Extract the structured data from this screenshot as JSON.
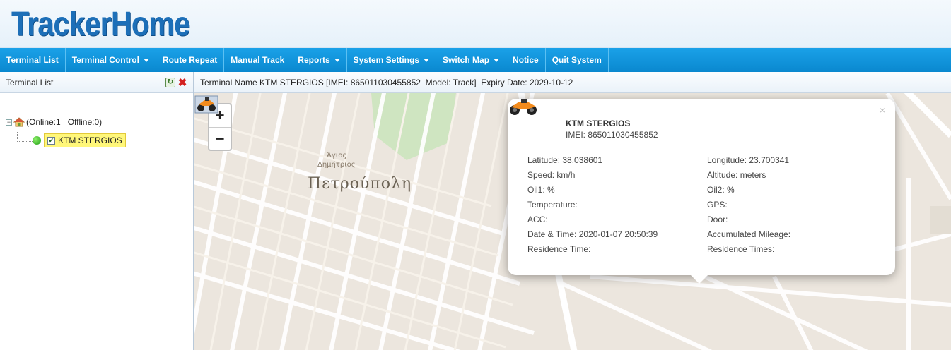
{
  "app": {
    "logo": "TrackerHome"
  },
  "nav": [
    {
      "label": "Terminal List",
      "dropdown": false
    },
    {
      "label": "Terminal Control",
      "dropdown": true
    },
    {
      "label": "Route Repeat",
      "dropdown": false
    },
    {
      "label": "Manual Track",
      "dropdown": false
    },
    {
      "label": "Reports",
      "dropdown": true
    },
    {
      "label": "System Settings",
      "dropdown": true
    },
    {
      "label": "Switch Map",
      "dropdown": true
    },
    {
      "label": "Notice",
      "dropdown": false
    },
    {
      "label": "Quit System",
      "dropdown": false
    }
  ],
  "sidebar": {
    "title": "Terminal List",
    "group_label": "(Online:1   Offline:0)",
    "device_name": "KTM STERGIOS"
  },
  "info_bar": {
    "text": "Terminal Name KTM STERGIOS [IMEI: 865011030455852  Model: Track]  Expiry Date: 2029-10-12"
  },
  "map": {
    "zoom_in": "+",
    "zoom_out": "−",
    "district_label": "Πετρούπολη",
    "place_label_1": "Άγιος",
    "place_label_2": "Δημήτριος"
  },
  "popup": {
    "close": "×",
    "vehicle_name": "KTM STERGIOS",
    "imei": "IMEI: 865011030455852",
    "left_fields": [
      "Latitude: 38.038601",
      "Speed: km/h",
      "Oil1: %",
      "Temperature:",
      "ACC:",
      "Date & Time: 2020-01-07 20:50:39",
      "Residence Time:"
    ],
    "right_fields": [
      "Longitude: 23.700341",
      "Altitude: meters",
      "Oil2: %",
      "GPS:",
      "Door:",
      "Accumulated Mileage:",
      "Residence Times:"
    ]
  },
  "colors": {
    "nav_bg": "#0a88cf",
    "logo": "#1d6fb8",
    "highlight": "#fff77a",
    "delete": "#d32020"
  }
}
